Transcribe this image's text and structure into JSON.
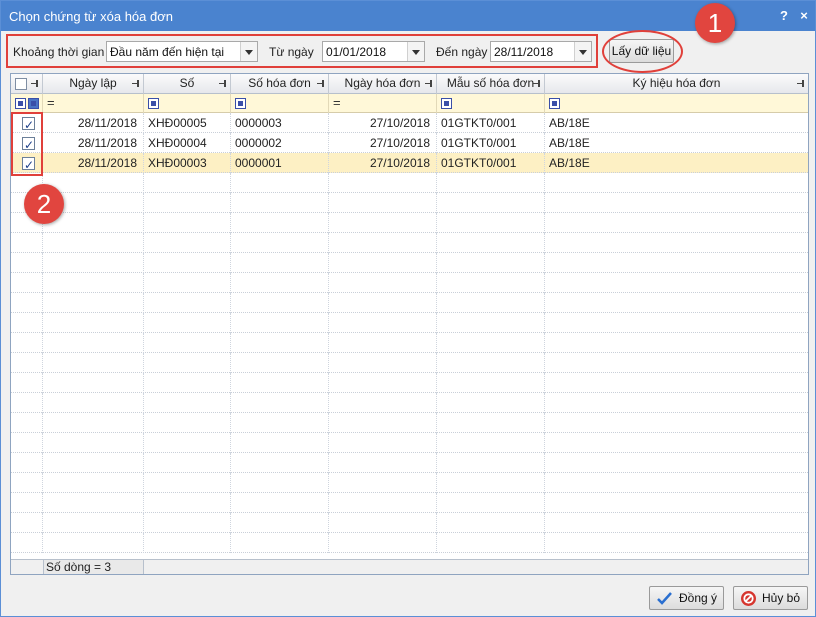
{
  "window": {
    "title": "Chọn chứng từ xóa hóa đơn",
    "help_label": "?",
    "close_label": "×"
  },
  "filter_bar": {
    "period_label": "Khoảng thời gian",
    "period_value": "Đầu năm đến hiện tại",
    "from_label": "Từ ngày",
    "from_value": "01/01/2018",
    "to_label": "Đến ngày",
    "to_value": "28/11/2018",
    "fetch_label": "Lấy dữ liệu"
  },
  "annotations": {
    "badge_1": "1",
    "badge_2": "2",
    "accent_color": "#e1453f"
  },
  "grid": {
    "columns": [
      "Ngày lập",
      "Số",
      "Số hóa đơn",
      "Ngày hóa đơn",
      "Mẫu số hóa đơn",
      "Ký hiệu hóa đơn"
    ],
    "rows": [
      {
        "checked": true,
        "ngay_lap": "28/11/2018",
        "so": "XHĐ00005",
        "so_hoa_don": "0000003",
        "ngay_hoa_don": "27/10/2018",
        "mau_so": "01GTKT0/001",
        "ky_hieu": "AB/18E"
      },
      {
        "checked": true,
        "ngay_lap": "28/11/2018",
        "so": "XHĐ00004",
        "so_hoa_don": "0000002",
        "ngay_hoa_don": "27/10/2018",
        "mau_so": "01GTKT0/001",
        "ky_hieu": "AB/18E"
      },
      {
        "checked": true,
        "ngay_lap": "28/11/2018",
        "so": "XHĐ00003",
        "so_hoa_don": "0000001",
        "ngay_hoa_don": "27/10/2018",
        "mau_so": "01GTKT0/001",
        "ky_hieu": "AB/18E"
      }
    ],
    "row_count_label": "Số dòng = 3"
  },
  "actions": {
    "ok_label": "Đồng ý",
    "cancel_label": "Hủy bỏ"
  }
}
